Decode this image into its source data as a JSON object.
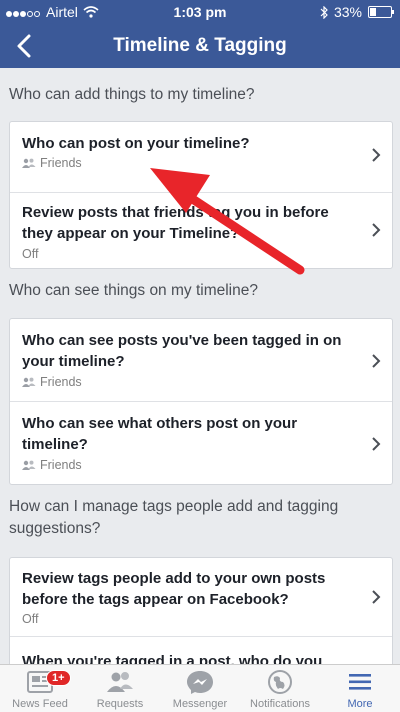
{
  "status_bar": {
    "carrier": "Airtel",
    "time": "1:03 pm",
    "battery": "33%"
  },
  "nav": {
    "title": "Timeline & Tagging",
    "back_icon": "back-chevron-icon"
  },
  "sections": [
    {
      "heading": "Who can add things to my timeline?",
      "rows": [
        {
          "main": "Who can post on your timeline?",
          "sub": "Friends",
          "sub_icon": "friends-icon"
        },
        {
          "main": "Review posts that friends tag you in before they appear on your Timeline?",
          "sub": "Off"
        }
      ]
    },
    {
      "heading": "Who can see things on my timeline?",
      "rows": [
        {
          "main": "Who can see posts you've been tagged in on your timeline?",
          "sub": "Friends",
          "sub_icon": "friends-icon"
        },
        {
          "main": "Who can see what others post on your timeline?",
          "sub": "Friends",
          "sub_icon": "friends-icon"
        }
      ]
    },
    {
      "heading": "How can I manage tags people add and tagging suggestions?",
      "rows": [
        {
          "main": "Review tags people add to your own posts before the tags appear on Facebook?",
          "sub": "Off"
        },
        {
          "main": "When you're tagged in a post, who do you want"
        }
      ]
    }
  ],
  "tabs": [
    {
      "label": "News Feed",
      "icon": "news-feed-icon",
      "badge": "1+"
    },
    {
      "label": "Requests",
      "icon": "requests-icon"
    },
    {
      "label": "Messenger",
      "icon": "messenger-icon"
    },
    {
      "label": "Notifications",
      "icon": "notifications-globe-icon"
    },
    {
      "label": "More",
      "icon": "more-menu-icon",
      "active": true
    }
  ],
  "colors": {
    "brand": "#3b5998",
    "annotation_arrow": "#e8252a",
    "active_tab": "#4267b2"
  }
}
